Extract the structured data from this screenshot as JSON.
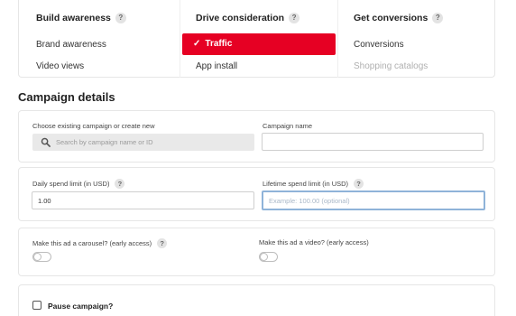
{
  "objectives": {
    "columns": [
      {
        "heading": "Build awareness",
        "items": [
          "Brand awareness",
          "Video views"
        ]
      },
      {
        "heading": "Drive consideration",
        "items": [
          "Traffic",
          "App install"
        ]
      },
      {
        "heading": "Get conversions",
        "items": [
          "Conversions",
          "Shopping catalogs"
        ]
      }
    ],
    "selected": "Traffic",
    "disabled": [
      "Shopping catalogs"
    ],
    "help_icon": "?",
    "check_icon": "✓"
  },
  "campaign_details": {
    "title": "Campaign details",
    "existing_campaign": {
      "label": "Choose existing campaign or create new",
      "placeholder": "Search by campaign name or ID"
    },
    "campaign_name": {
      "label": "Campaign name",
      "value": ""
    },
    "daily_spend": {
      "label": "Daily spend limit (in USD)",
      "value": "1.00"
    },
    "lifetime_spend": {
      "label": "Lifetime spend limit (in USD)",
      "placeholder": "Example: 100.00 (optional)"
    },
    "carousel": {
      "label": "Make this ad a carousel? (early access)",
      "on": false
    },
    "video": {
      "label": "Make this ad a video? (early access)",
      "on": false
    },
    "pause": {
      "label": "Pause campaign?",
      "checked": false
    }
  },
  "colors": {
    "accent": "#e60023",
    "focus_border": "#8fb3d9"
  }
}
